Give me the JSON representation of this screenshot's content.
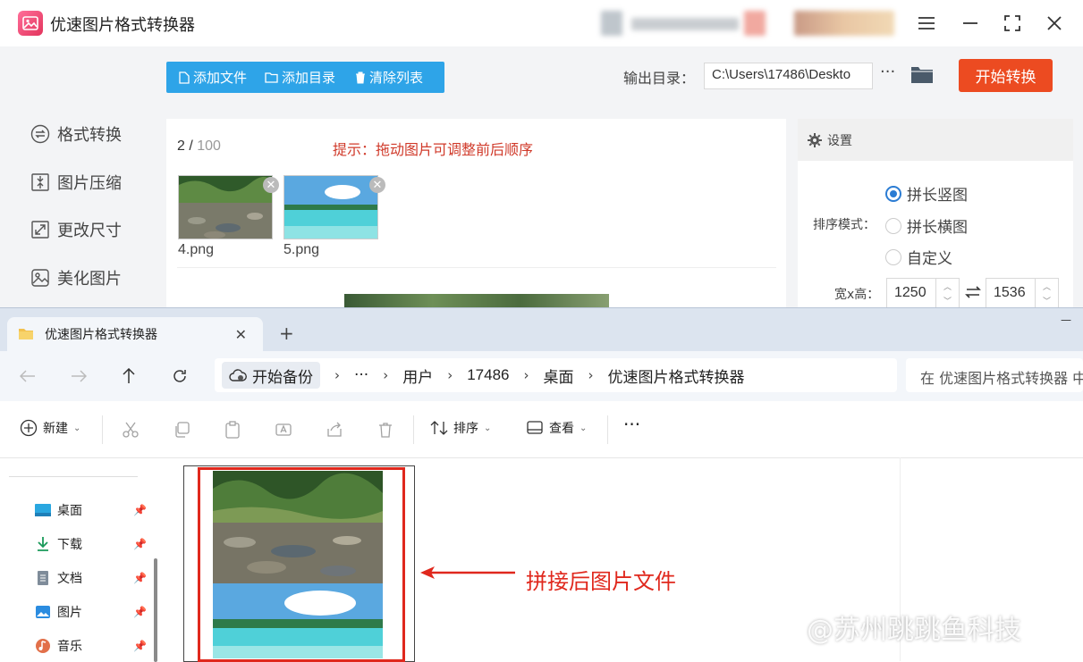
{
  "app": {
    "title": "优速图片格式转换器",
    "sidebar": [
      {
        "label": "格式转换",
        "icon": "convert-icon"
      },
      {
        "label": "图片压缩",
        "icon": "compress-icon"
      },
      {
        "label": "更改尺寸",
        "icon": "resize-icon"
      },
      {
        "label": "美化图片",
        "icon": "beautify-icon"
      }
    ],
    "toolbar": {
      "add_file": "添加文件",
      "add_dir": "添加目录",
      "clear_list": "清除列表"
    },
    "output": {
      "label": "输出目录：",
      "path": "C:\\Users\\17486\\Deskto",
      "more": "···"
    },
    "start_button": "开始转换",
    "files": {
      "count": "2",
      "separator": " / ",
      "max": "100",
      "hint": "提示：拖动图片可调整前后顺序",
      "items": [
        {
          "name": "4.png"
        },
        {
          "name": "5.png"
        }
      ]
    },
    "settings": {
      "title": "设置",
      "sort_label": "排序模式：",
      "modes": [
        "拼长竖图",
        "拼长横图",
        "自定义"
      ],
      "selected_mode": "拼长竖图",
      "size_label": "宽x高：",
      "width": "1250",
      "height": "1536"
    }
  },
  "explorer": {
    "tab_title": "优速图片格式转换器",
    "breadcrumb": {
      "backup": "开始备份",
      "ellipsis": "···",
      "items": [
        "用户",
        "17486",
        "桌面",
        "优速图片格式转换器"
      ]
    },
    "search_placeholder": "在 优速图片格式转换器 中搜索",
    "commands": {
      "new": "新建",
      "sort": "排序",
      "view": "查看",
      "more": "···"
    },
    "nav": [
      {
        "label": "桌面",
        "icon": "desktop-icon"
      },
      {
        "label": "下载",
        "icon": "download-icon"
      },
      {
        "label": "文档",
        "icon": "document-icon"
      },
      {
        "label": "图片",
        "icon": "pictures-icon"
      },
      {
        "label": "音乐",
        "icon": "music-icon"
      }
    ]
  },
  "annotation": "拼接后图片文件",
  "watermark": "@苏州跳跳鱼科技",
  "colors": {
    "accent_blue": "#2ea4e8",
    "start_orange": "#ec4b21",
    "hint_red": "#d03a2a",
    "annotation_red": "#e0281d"
  }
}
